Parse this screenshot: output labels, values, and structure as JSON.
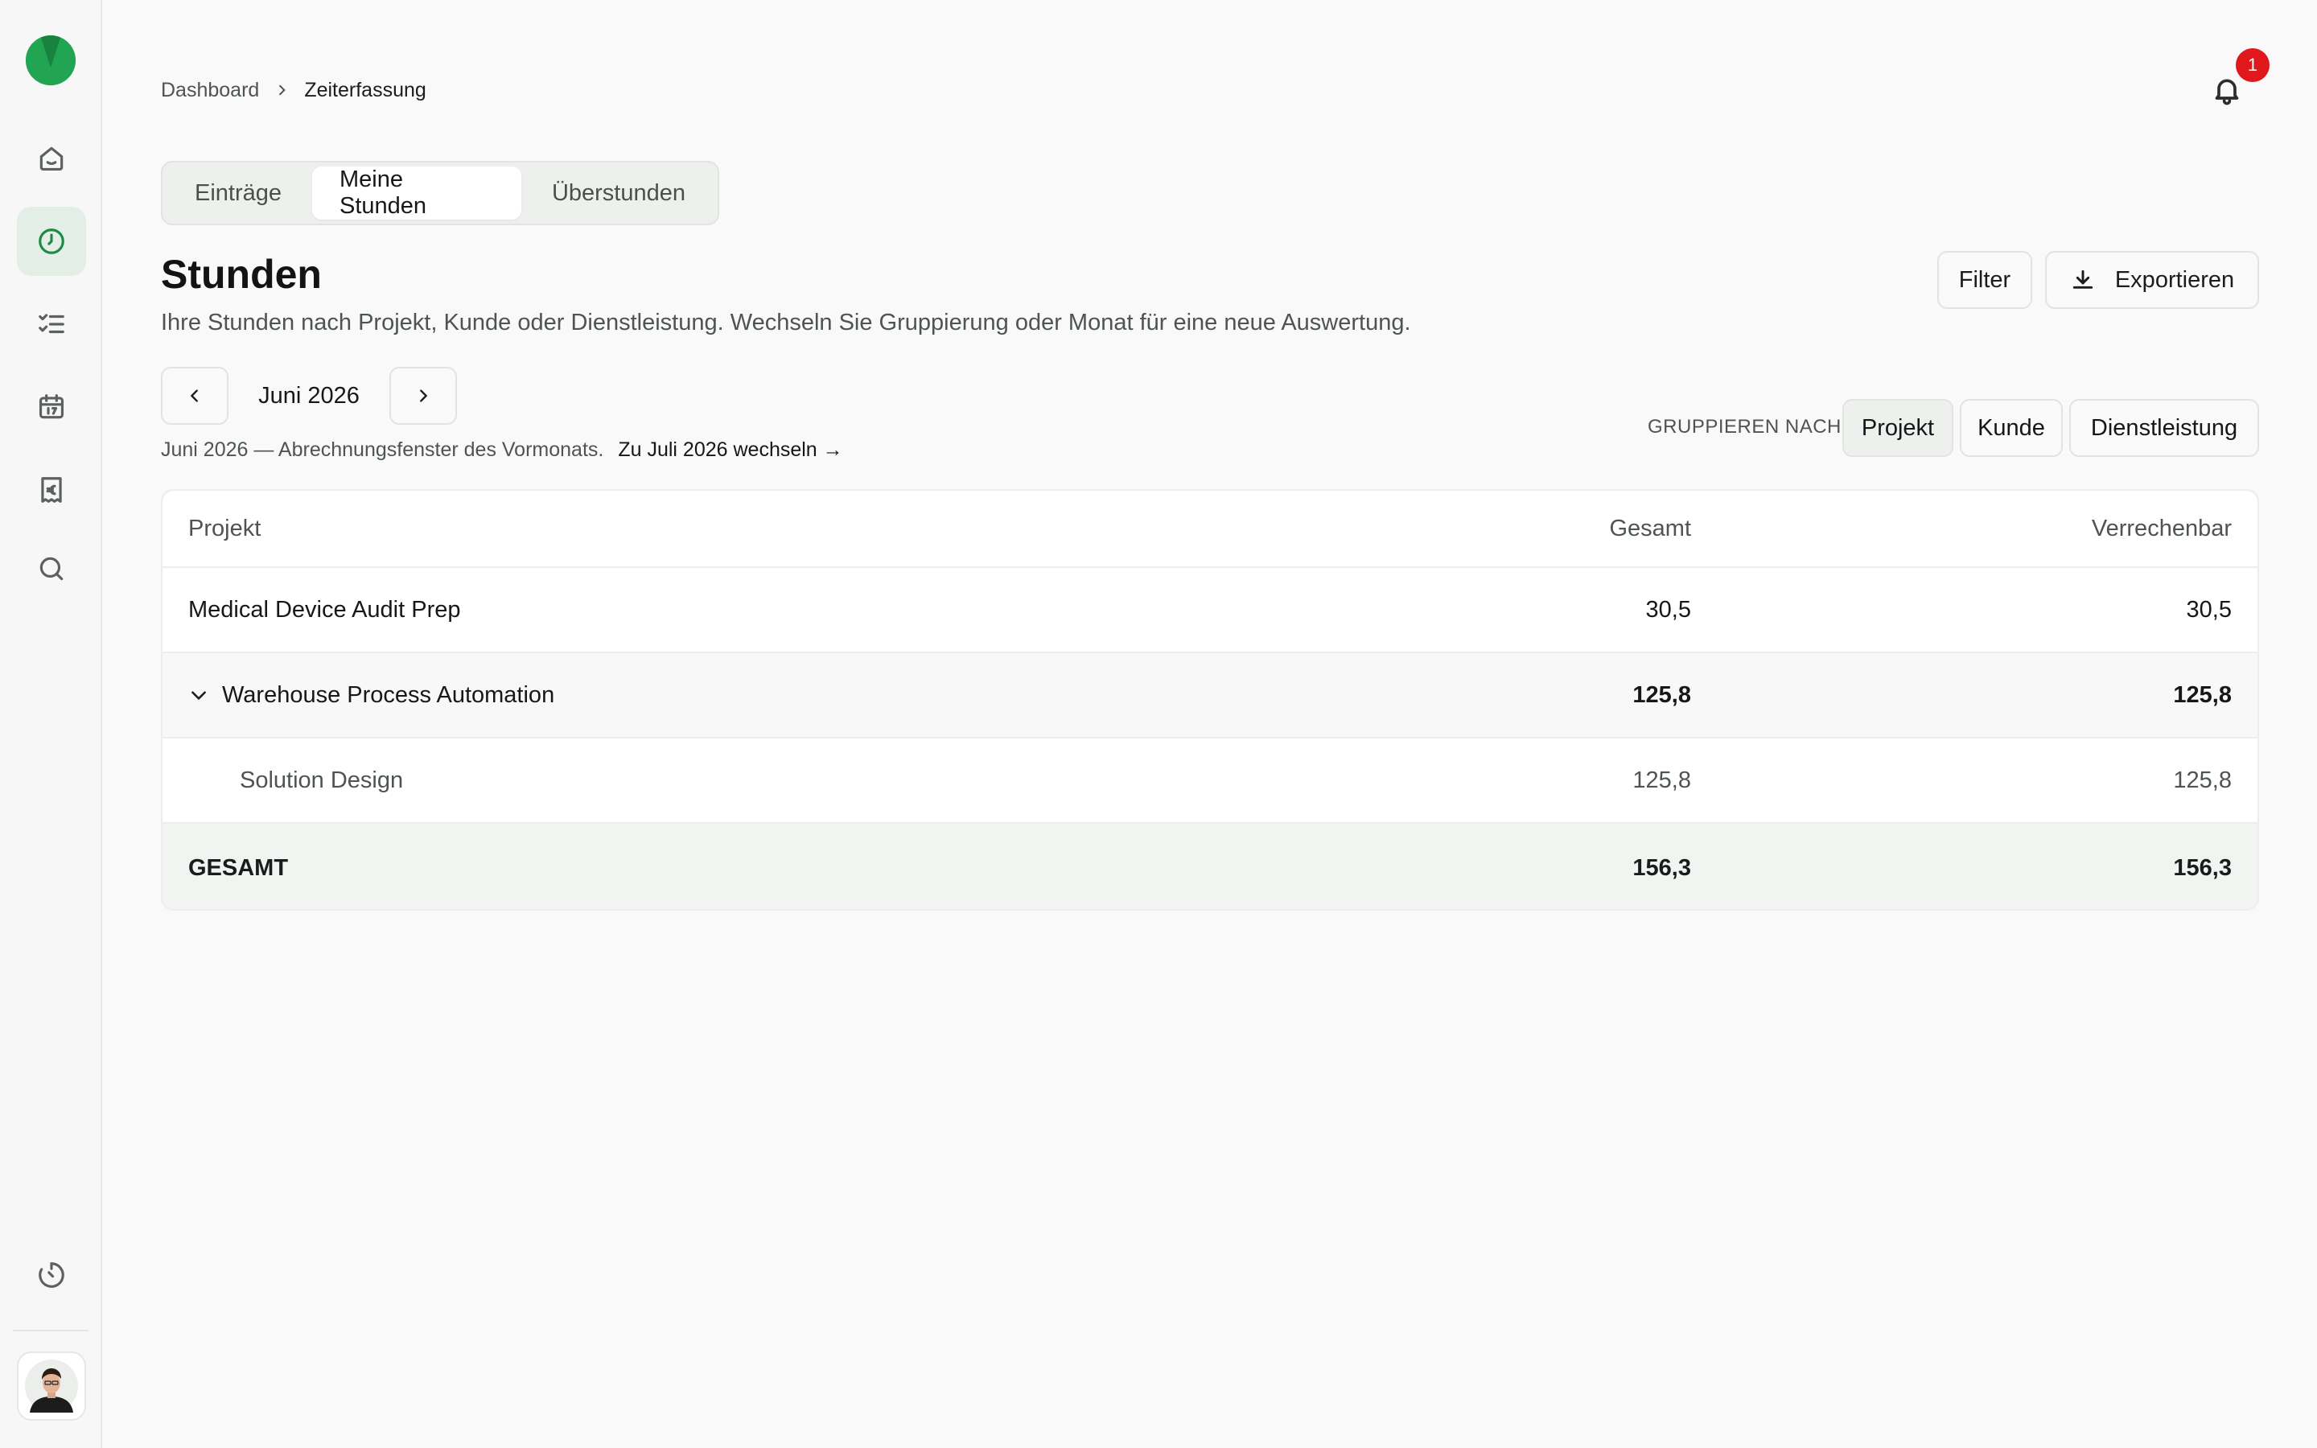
{
  "breadcrumb": {
    "parent": "Dashboard",
    "current": "Zeiterfassung"
  },
  "notifications": {
    "count": "1"
  },
  "tabs": [
    {
      "label": "Einträge",
      "active": false
    },
    {
      "label": "Meine Stunden",
      "active": true
    },
    {
      "label": "Überstunden",
      "active": false
    }
  ],
  "page": {
    "title": "Stunden",
    "subtitle": "Ihre Stunden nach Projekt, Kunde oder Dienstleistung. Wechseln Sie Gruppierung oder Monat für eine neue Auswertung."
  },
  "actions": {
    "filter_label": "Filter",
    "export_label": "Exportieren"
  },
  "period": {
    "month": "Juni 2026",
    "info": "Juni 2026 — Abrechnungsfenster des Vormonats.",
    "switch_link": "Zu Juli 2026 wechseln →"
  },
  "grouping": {
    "label": "GRUPPIEREN NACH",
    "options": [
      "Projekt",
      "Kunde",
      "Dienstleistung"
    ],
    "selected": "Projekt"
  },
  "table": {
    "columns": {
      "name": "Projekt",
      "total": "Gesamt",
      "billable": "Verrechenbar"
    },
    "rows": [
      {
        "name": "Medical Device Audit Prep",
        "total": "30,5",
        "billable": "30,5"
      },
      {
        "name": "Warehouse Process Automation",
        "total": "125,8",
        "billable": "125,8",
        "expanded": true
      },
      {
        "name": "Solution Design",
        "total": "125,8",
        "billable": "125,8"
      }
    ],
    "footer": {
      "name": "GESAMT",
      "total": "156,3",
      "billable": "156,3"
    }
  },
  "colors": {
    "brand": "#22a552",
    "active_nav_bg": "#e3efe6",
    "badge": "#e0171d"
  },
  "icons": {
    "sidebar": [
      "home-icon",
      "clock-icon",
      "checklist-icon",
      "calendar-icon",
      "receipt-euro-icon",
      "search-icon",
      "timer-icon"
    ],
    "header": "bell-icon",
    "export": "download-icon"
  }
}
